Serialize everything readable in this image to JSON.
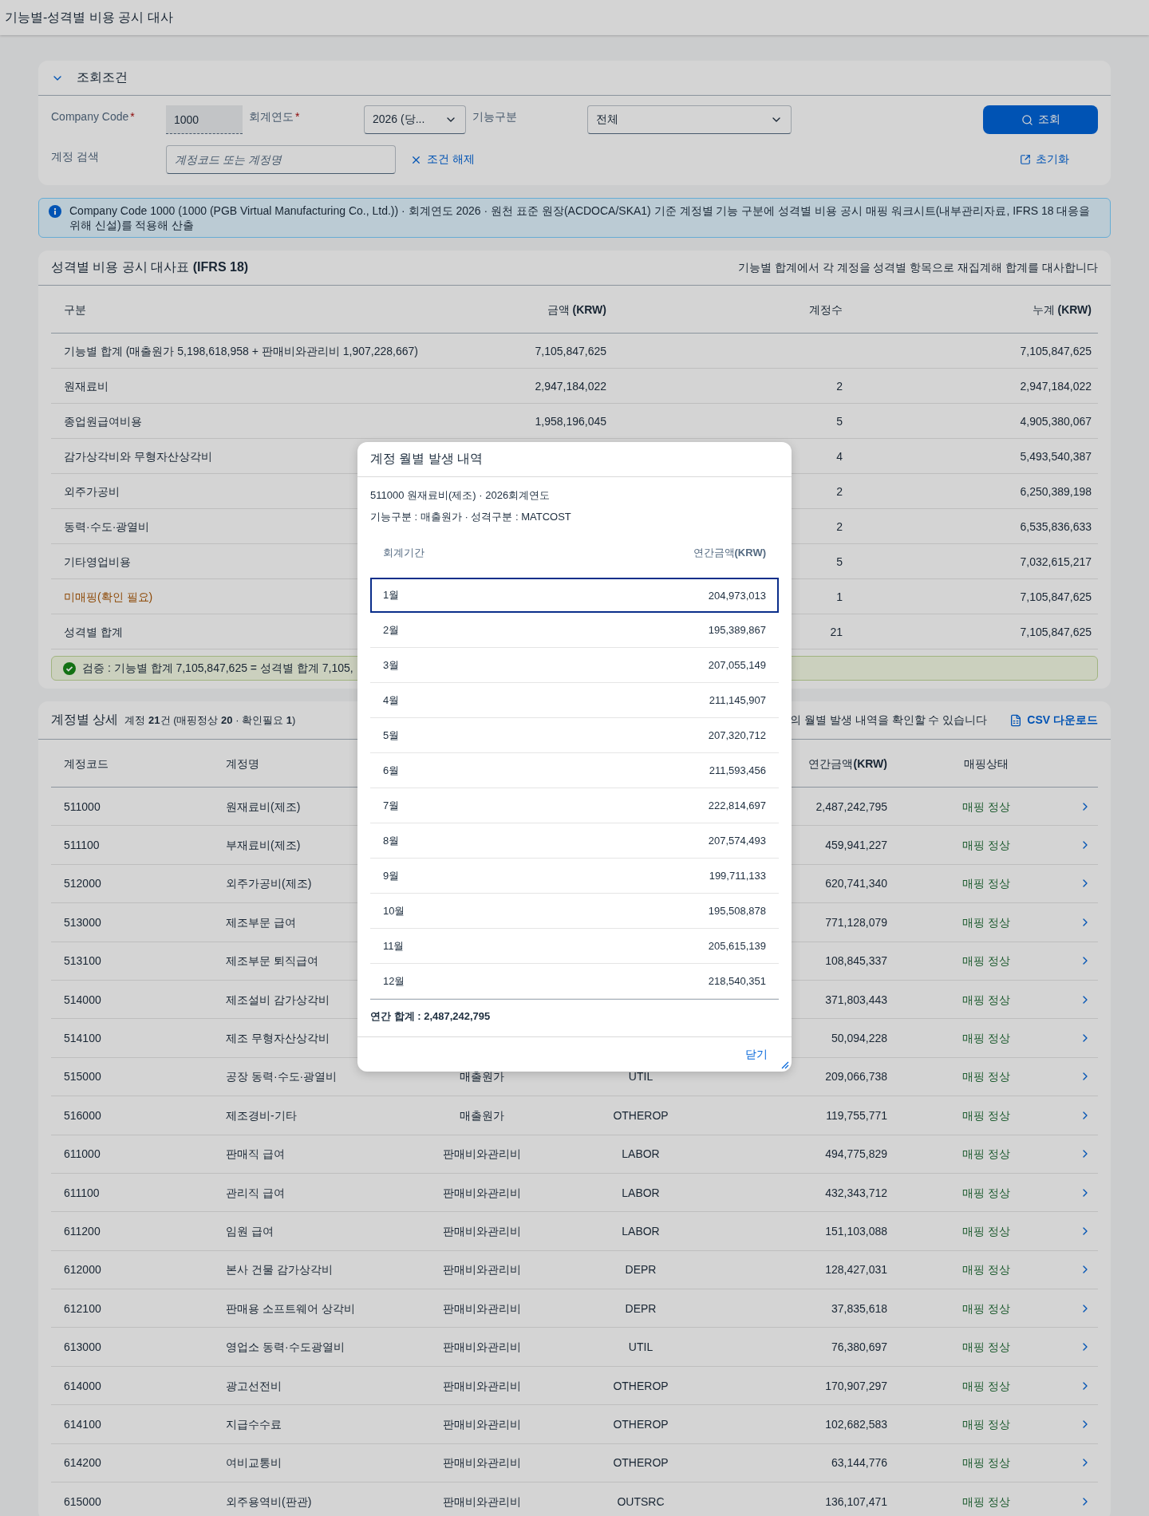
{
  "page_title": "기능별-성격별 비용 공시 대사",
  "filter": {
    "title": "조회조건",
    "expanded": true,
    "company_code": {
      "label": "Company Code",
      "mark": "*",
      "value": "1000"
    },
    "fiscal_year": {
      "label": "회계연도",
      "mark": "*",
      "value": "2026 (당..."
    },
    "function": {
      "label": "기능구분",
      "value": "전체"
    },
    "search_button": "조회",
    "account_search": {
      "label": "계정 검색",
      "placeholder": "계정코드 또는 계정명"
    },
    "clear_link": "조건 해제",
    "reset_link": "초기화"
  },
  "info": "Company Code 1000 (1000 (PGB Virtual Manufacturing Co., Ltd.)) · 회계연도 2026 · 원천 표준 원장(ACDOCA/SKA1) 기준 계정별 기능 구분에 성격별 비용 공시 매핑 워크시트(내부관리자료, IFRS 18 대응을 위해 신설)를 적용해 산출",
  "summary": {
    "title": "성격별 비용 공시 대사표 **(IFRS 18)**",
    "hint": "기능별 합계에서 각 계정을 성격별 항목으로 재집계해 합계를 대사합니다",
    "columns": {
      "label": "구분",
      "amount": "금액 **(KRW)**",
      "count": "계정수",
      "cumulative": "누계 **(KRW)**"
    },
    "rows": [
      {
        "label": "기능별 합계 (매출원가 5,198,618,958 + 판매비와관리비 1,907,228,667)",
        "amount": "7,105,847,625",
        "cumulative": "7,105,847,625",
        "warning": false
      },
      {
        "label": "원재료비",
        "amount": "2,947,184,022",
        "count": "2",
        "cumulative": "2,947,184,022",
        "warning": false
      },
      {
        "label": "종업원급여비용",
        "amount": "1,958,196,045",
        "count": "5",
        "cumulative": "4,905,380,067",
        "warning": false
      },
      {
        "label": "감가상각비와 무형자산상각비",
        "count": "4",
        "cumulative": "5,493,540,387",
        "warning": false
      },
      {
        "label": "외주가공비",
        "count": "2",
        "cumulative": "6,250,389,198",
        "warning": false
      },
      {
        "label": "동력·수도·광열비",
        "count": "2",
        "cumulative": "6,535,836,633",
        "warning": false
      },
      {
        "label": "기타영업비용",
        "count": "5",
        "cumulative": "7,032,615,217",
        "warning": false
      },
      {
        "label": "미매핑(확인 필요)",
        "count": "1",
        "cumulative": "7,105,847,625",
        "warning": true
      },
      {
        "label": "성격별 합계",
        "count": "21",
        "cumulative": "7,105,847,625",
        "warning": false
      }
    ],
    "verification": "검증 : 기능별 합계 7,105,847,625 = 성격별 합계 7,105,"
  },
  "detail": {
    "title": "계정별 상세",
    "count": "계정 **21**건 (매핑정상 **20** · 확인필요 **1**)",
    "hint": "의 월별 발생 내역을 확인할 수 있습니다",
    "csv_link": "CSV 다운로드",
    "columns": {
      "code": "계정코드",
      "name": "계정명",
      "amount": "연간금액**(KRW)**",
      "status": "매핑상태"
    },
    "rows": [
      {
        "code": "511000",
        "name": "원재료비(제조)",
        "amount": "2,487,242,795",
        "status": "매핑 정상",
        "ok": true
      },
      {
        "code": "511100",
        "name": "부재료비(제조)",
        "amount": "459,941,227",
        "status": "매핑 정상",
        "ok": true
      },
      {
        "code": "512000",
        "name": "외주가공비(제조)",
        "amount": "620,741,340",
        "status": "매핑 정상",
        "ok": true
      },
      {
        "code": "513000",
        "name": "제조부문 급여",
        "amount": "771,128,079",
        "status": "매핑 정상",
        "ok": true
      },
      {
        "code": "513100",
        "name": "제조부문 퇴직급여",
        "amount": "108,845,337",
        "status": "매핑 정상",
        "ok": true
      },
      {
        "code": "514000",
        "name": "제조설비 감가상각비",
        "amount": "371,803,443",
        "status": "매핑 정상",
        "ok": true
      },
      {
        "code": "514100",
        "name": "제조 무형자산상각비",
        "amount": "50,094,228",
        "status": "매핑 정상",
        "ok": true
      },
      {
        "code": "515000",
        "name": "공장 동력·수도·광열비",
        "function": "매출원가",
        "nature": "UTIL",
        "amount": "209,066,738",
        "status": "매핑 정상",
        "ok": true
      },
      {
        "code": "516000",
        "name": "제조경비-기타",
        "function": "매출원가",
        "nature": "OTHEROP",
        "amount": "119,755,771",
        "status": "매핑 정상",
        "ok": true
      },
      {
        "code": "611000",
        "name": "판매직 급여",
        "function": "판매비와관리비",
        "nature": "LABOR",
        "amount": "494,775,829",
        "status": "매핑 정상",
        "ok": true
      },
      {
        "code": "611100",
        "name": "관리직 급여",
        "function": "판매비와관리비",
        "nature": "LABOR",
        "amount": "432,343,712",
        "status": "매핑 정상",
        "ok": true
      },
      {
        "code": "611200",
        "name": "임원 급여",
        "function": "판매비와관리비",
        "nature": "LABOR",
        "amount": "151,103,088",
        "status": "매핑 정상",
        "ok": true
      },
      {
        "code": "612000",
        "name": "본사 건물 감가상각비",
        "function": "판매비와관리비",
        "nature": "DEPR",
        "amount": "128,427,031",
        "status": "매핑 정상",
        "ok": true
      },
      {
        "code": "612100",
        "name": "판매용 소프트웨어 상각비",
        "function": "판매비와관리비",
        "nature": "DEPR",
        "amount": "37,835,618",
        "status": "매핑 정상",
        "ok": true
      },
      {
        "code": "613000",
        "name": "영업소 동력·수도광열비",
        "function": "판매비와관리비",
        "nature": "UTIL",
        "amount": "76,380,697",
        "status": "매핑 정상",
        "ok": true
      },
      {
        "code": "614000",
        "name": "광고선전비",
        "function": "판매비와관리비",
        "nature": "OTHEROP",
        "amount": "170,907,297",
        "status": "매핑 정상",
        "ok": true
      },
      {
        "code": "614100",
        "name": "지급수수료",
        "function": "판매비와관리비",
        "nature": "OTHEROP",
        "amount": "102,682,583",
        "status": "매핑 정상",
        "ok": true
      },
      {
        "code": "614200",
        "name": "여비교통비",
        "function": "판매비와관리비",
        "nature": "OTHEROP",
        "amount": "63,144,776",
        "status": "매핑 정상",
        "ok": true
      },
      {
        "code": "615000",
        "name": "외주용역비(판관)",
        "function": "판매비와관리비",
        "nature": "OUTSRC",
        "amount": "136,107,471",
        "status": "매핑 정상",
        "ok": true
      }
    ]
  },
  "modal": {
    "title": "계정 월별 발생 내역",
    "subtitle": "511000 원재료비(제조) · 2026회계연도",
    "meta": "기능구분 : 매출원가 · 성격구분 : MATCOST",
    "columns": {
      "period": "회계기간",
      "amount": "연간금액**(KRW)**"
    },
    "rows": [
      {
        "period": "1월",
        "amount": "204,973,013",
        "selected": true
      },
      {
        "period": "2월",
        "amount": "195,389,867",
        "selected": false
      },
      {
        "period": "3월",
        "amount": "207,055,149",
        "selected": false
      },
      {
        "period": "4월",
        "amount": "211,145,907",
        "selected": false
      },
      {
        "period": "5월",
        "amount": "207,320,712",
        "selected": false
      },
      {
        "period": "6월",
        "amount": "211,593,456",
        "selected": false
      },
      {
        "period": "7월",
        "amount": "222,814,697",
        "selected": false
      },
      {
        "period": "8월",
        "amount": "207,574,493",
        "selected": false
      },
      {
        "period": "9월",
        "amount": "199,711,133",
        "selected": false
      },
      {
        "period": "10월",
        "amount": "195,508,878",
        "selected": false
      },
      {
        "period": "11월",
        "amount": "205,615,139",
        "selected": false
      },
      {
        "period": "12월",
        "amount": "218,540,351",
        "selected": false
      }
    ],
    "total": "연간 합계 : 2,487,242,795",
    "close_button": "닫기"
  }
}
